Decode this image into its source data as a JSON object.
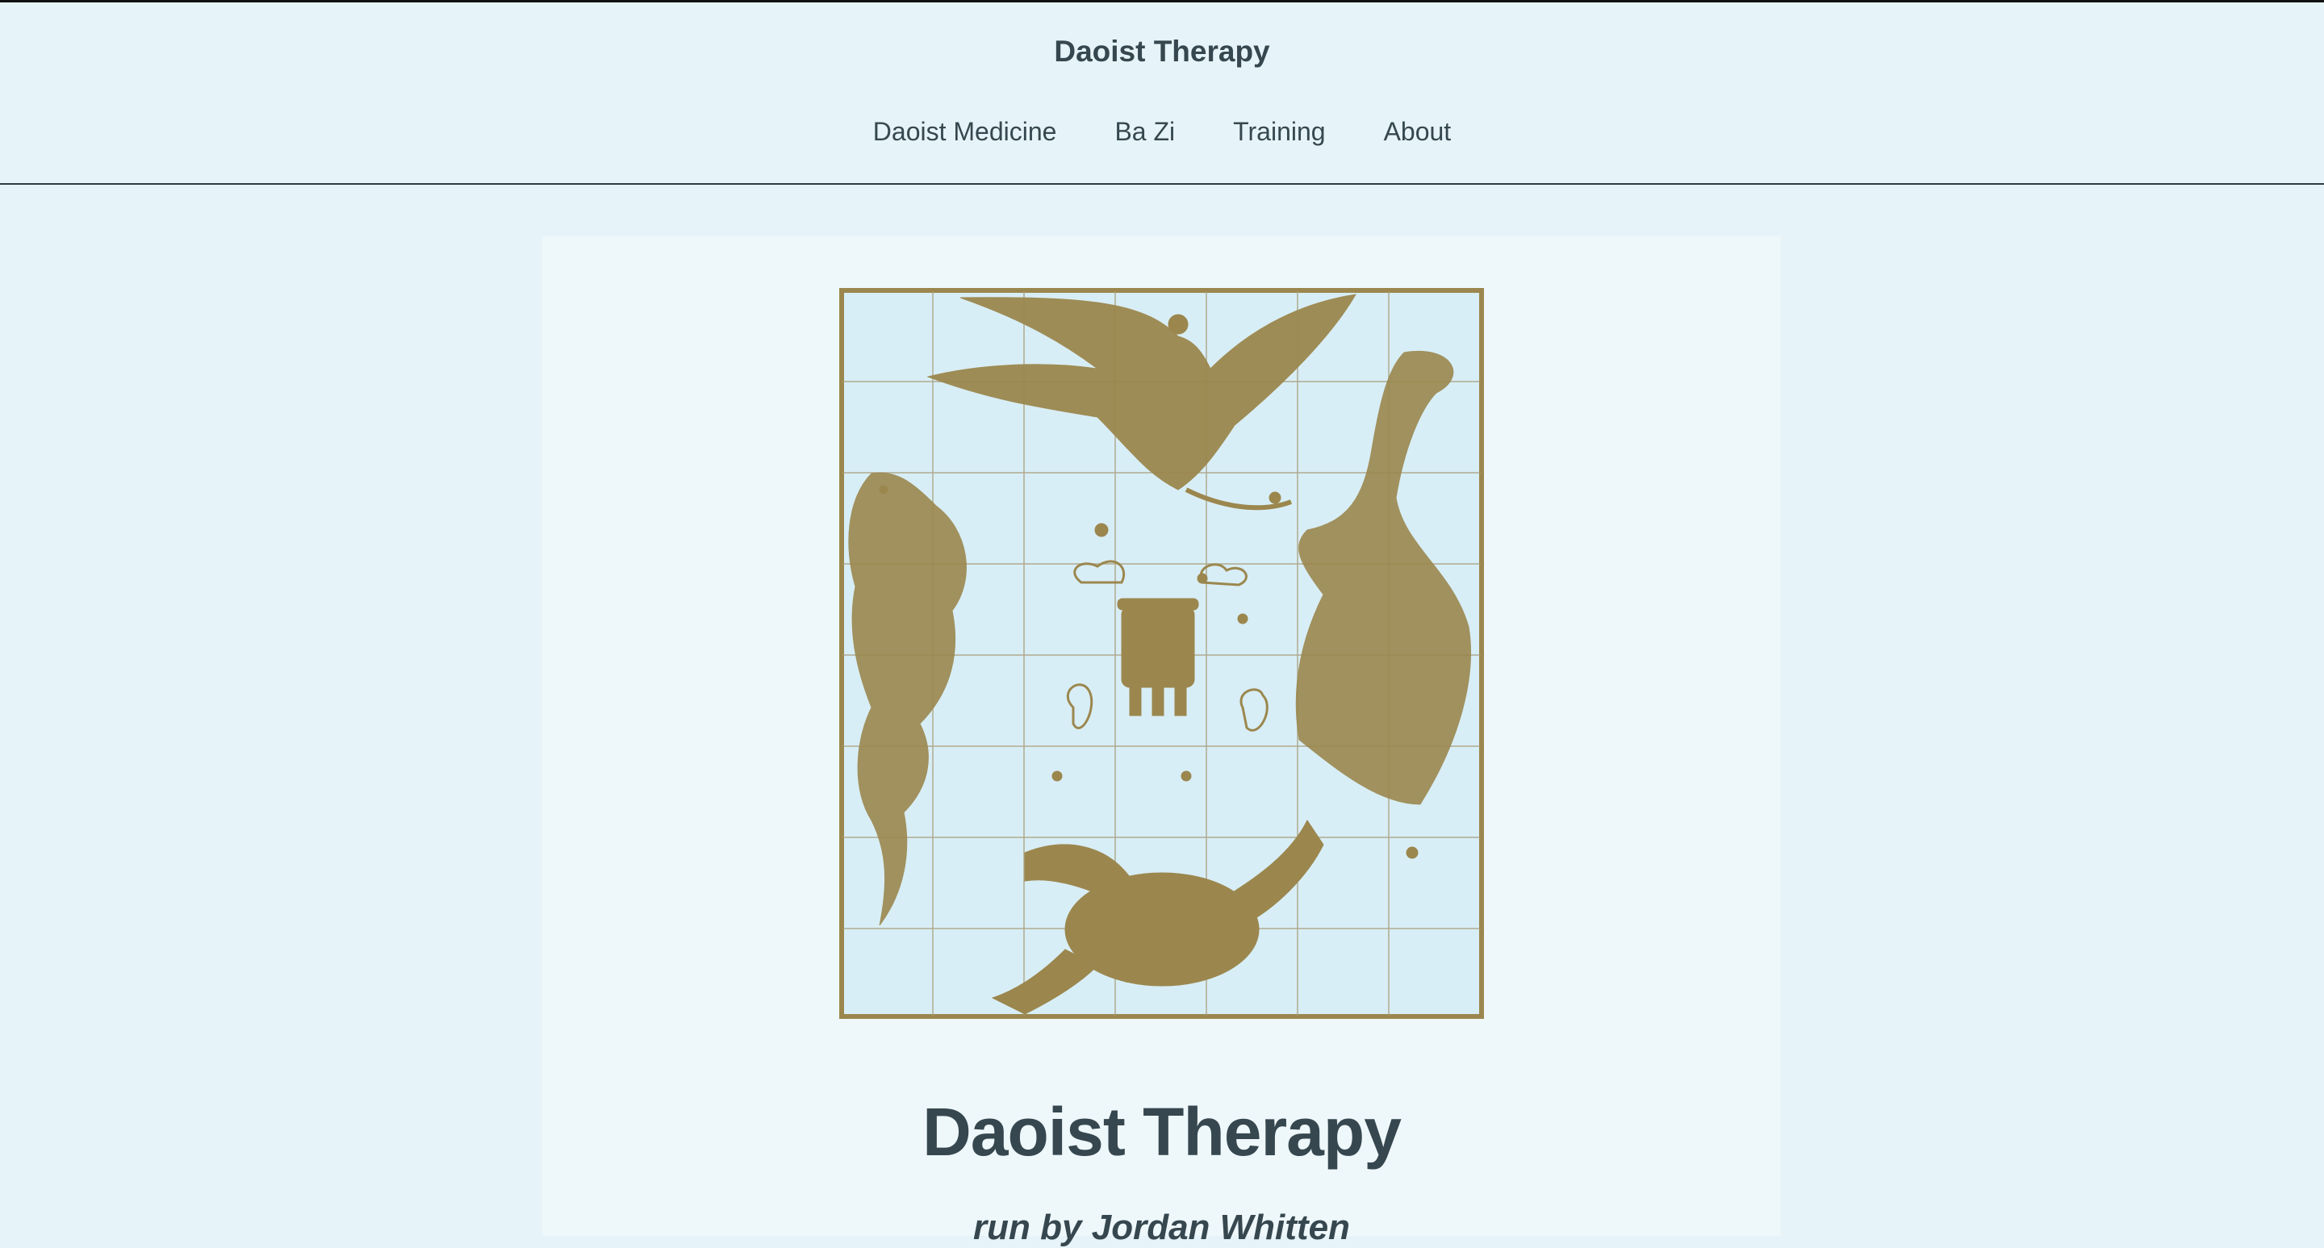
{
  "header": {
    "site_title": "Daoist Therapy",
    "nav": [
      {
        "label": "Daoist Medicine"
      },
      {
        "label": "Ba Zi"
      },
      {
        "label": "Training"
      },
      {
        "label": "About"
      }
    ]
  },
  "hero": {
    "image_icon": "papercut-four-symbols-illustration",
    "title": "Daoist Therapy",
    "byline": "run by Jordan Whitten"
  },
  "colors": {
    "background": "#e6f4f9",
    "card": "#eef7fa",
    "text": "#36474f",
    "art_gold": "#9b874e",
    "art_bg": "#d8eef6"
  }
}
